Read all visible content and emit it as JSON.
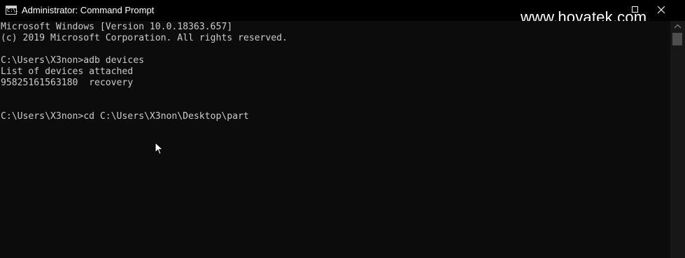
{
  "window": {
    "title": "Administrator: Command Prompt",
    "icon": "cmd-icon",
    "icon_glyph": "C:\\."
  },
  "watermark": "www.hovatek.com",
  "controls": {
    "minimize_label": "—",
    "maximize": "maximize-icon",
    "close": "close-icon"
  },
  "console": {
    "lines": [
      "Microsoft Windows [Version 10.0.18363.657]",
      "(c) 2019 Microsoft Corporation. All rights reserved.",
      "",
      "C:\\Users\\X3non>adb devices",
      "List of devices attached",
      "95825161563180  recovery",
      "",
      "",
      "C:\\Users\\X3non>cd C:\\Users\\X3non\\Desktop\\part"
    ]
  },
  "colors": {
    "background": "#0c0c0c",
    "text": "#cccccc",
    "titlebar": "#000000"
  }
}
